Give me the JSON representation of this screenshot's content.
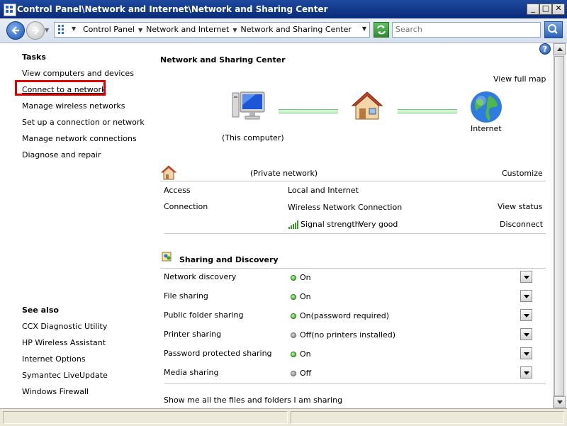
{
  "window": {
    "title": "Control Panel\\Network and Internet\\Network and Sharing Center",
    "minimize": "_",
    "maximize": "□",
    "close": "✕"
  },
  "address": {
    "crumbs": [
      "Control Panel",
      "Network and Internet",
      "Network and Sharing Center"
    ],
    "search_placeholder": "Search"
  },
  "tasks": {
    "heading": "Tasks",
    "items": [
      "View computers and devices",
      "Connect to a network",
      "Manage wireless networks",
      "Set up a connection or network",
      "Manage network connections",
      "Diagnose and repair"
    ]
  },
  "see_also": {
    "heading": "See also",
    "items": [
      "CCX Diagnostic Utility",
      "HP Wireless Assistant",
      "Internet Options",
      "Symantec LiveUpdate",
      "Windows Firewall"
    ]
  },
  "main": {
    "title": "Network and Sharing Center",
    "view_full_map": "View full map",
    "map": {
      "computer_label": "(This computer)",
      "internet_label": "Internet"
    },
    "network": {
      "type": "(Private network)",
      "customize": "Customize",
      "access_label": "Access",
      "access_value": "Local and Internet",
      "connection_label": "Connection",
      "connection_value": "Wireless Network Connection",
      "view_status": "View status",
      "signal_label": "Signal strength:",
      "signal_value": "Very good",
      "disconnect": "Disconnect"
    },
    "sharing": {
      "heading": "Sharing and Discovery",
      "rows": [
        {
          "label": "Network discovery",
          "status": "On",
          "on": true
        },
        {
          "label": "File sharing",
          "status": "On",
          "on": true
        },
        {
          "label": "Public folder sharing",
          "status": "On(password required)",
          "on": true
        },
        {
          "label": "Printer sharing",
          "status": "Off(no printers installed)",
          "on": false
        },
        {
          "label": "Password protected sharing",
          "status": "On",
          "on": true
        },
        {
          "label": "Media sharing",
          "status": "Off",
          "on": false
        }
      ],
      "show_all": "Show me all the files and folders I am sharing"
    }
  },
  "help_icon": "?",
  "colors": {
    "title_bar": "#1f4a9e",
    "highlight_box": "#e00000",
    "network_line": "#6fc46f",
    "status_on": "#2e9e1d",
    "status_off": "#7b7b7b"
  }
}
